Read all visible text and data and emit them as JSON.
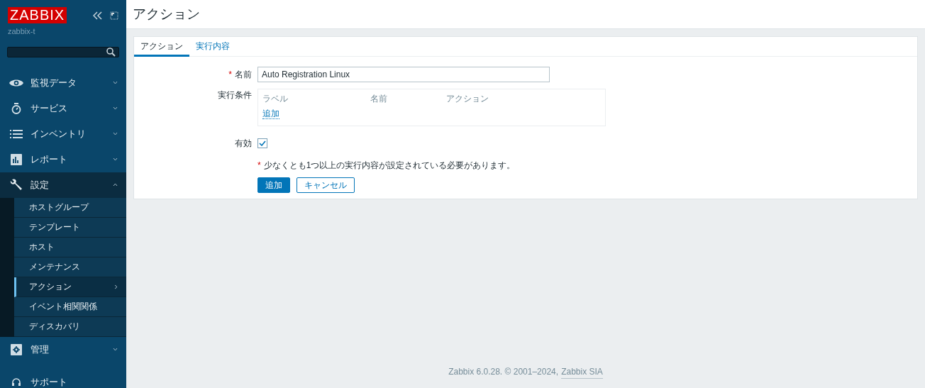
{
  "sidebar": {
    "logo": "ZABBIX",
    "server_name": "zabbix-t",
    "menu": [
      {
        "kind": "eye",
        "label": "監視データ",
        "expanded": false,
        "selected": false
      },
      {
        "kind": "timer",
        "label": "サービス",
        "expanded": false,
        "selected": false
      },
      {
        "kind": "list",
        "label": "インベントリ",
        "expanded": false,
        "selected": false
      },
      {
        "kind": "chart",
        "label": "レポート",
        "expanded": false,
        "selected": false
      },
      {
        "kind": "wrench",
        "label": "設定",
        "expanded": true,
        "selected": true,
        "children": [
          {
            "label": "ホストグループ",
            "selected": false
          },
          {
            "label": "テンプレート",
            "selected": false
          },
          {
            "label": "ホスト",
            "selected": false
          },
          {
            "label": "メンテナンス",
            "selected": false
          },
          {
            "label": "アクション",
            "selected": true,
            "has_submenu": true
          },
          {
            "label": "イベント相関関係",
            "selected": false
          },
          {
            "label": "ディスカバリ",
            "selected": false
          }
        ]
      },
      {
        "kind": "gear",
        "label": "管理",
        "expanded": false,
        "selected": false
      },
      {
        "kind": "headset",
        "label": "サポート",
        "selected": false
      }
    ]
  },
  "page_title": "アクション",
  "tabs": [
    {
      "label": "アクション",
      "selected": true
    },
    {
      "label": "実行内容",
      "selected": false
    }
  ],
  "form": {
    "required_mark": "*",
    "name_label": "名前",
    "name_value": "Auto Registration Linux",
    "conditions_label": "実行条件",
    "conditions_columns": [
      "ラベル",
      "名前",
      "アクション"
    ],
    "conditions_add": "追加",
    "enabled_label": "有効",
    "enabled": true,
    "note": "少なくとも1つ以上の実行内容が設定されている必要があります。",
    "buttons": [
      {
        "label": "追加",
        "kind": "primary"
      },
      {
        "label": "キャンセル",
        "kind": "secondary"
      }
    ]
  },
  "footer": {
    "text": "Zabbix 6.0.28. © 2001–2024,",
    "link": "Zabbix SIA"
  }
}
